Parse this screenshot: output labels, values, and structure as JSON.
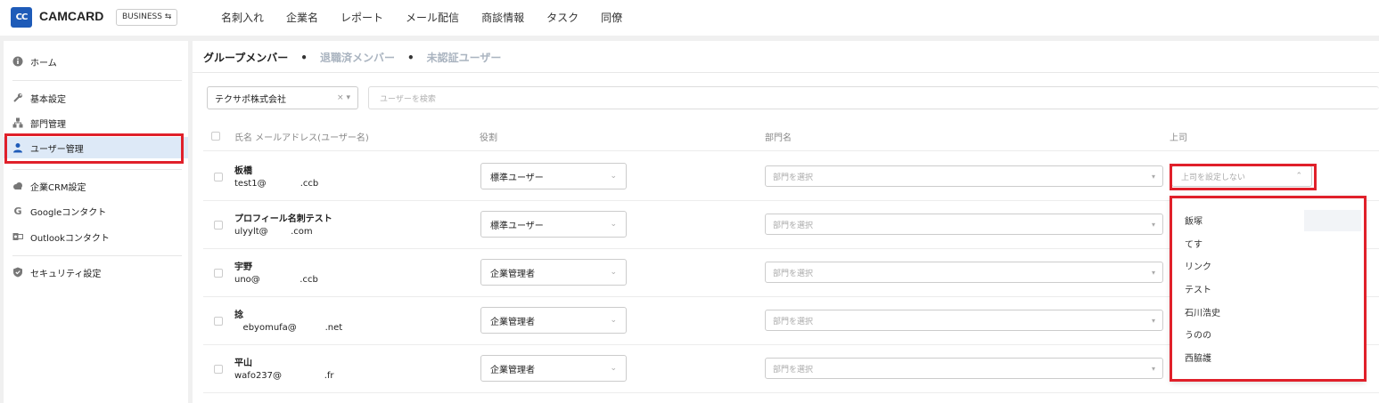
{
  "app": {
    "logo_letters": "CC",
    "name": "CAMCARD",
    "edition": "BUSINESS ⇆"
  },
  "top_nav": [
    "名刺入れ",
    "企業名",
    "レポート",
    "メール配信",
    "商談情報",
    "タスク",
    "同僚"
  ],
  "sidebar": {
    "items": [
      {
        "label": "ホーム",
        "icon": "info-icon"
      },
      {
        "label": "基本設定",
        "icon": "wrench-icon"
      },
      {
        "label": "部門管理",
        "icon": "org-chart-icon"
      },
      {
        "label": "ユーザー管理",
        "icon": "user-icon",
        "active": true
      },
      {
        "label": "企業CRM設定",
        "icon": "cloud-icon"
      },
      {
        "label": "Googleコンタクト",
        "icon": "google-icon"
      },
      {
        "label": "Outlookコンタクト",
        "icon": "outlook-icon"
      },
      {
        "label": "セキュリティ設定",
        "icon": "shield-icon"
      }
    ]
  },
  "tabs": {
    "active": "グループメンバー",
    "retired": "退職済メンバー",
    "unverified": "未認証ユーザー",
    "separator": "•"
  },
  "filters": {
    "company": "テクサポ株式会社",
    "clear": "×",
    "search_placeholder": "ユーザーを検索"
  },
  "table": {
    "headers": {
      "name_email": "氏名 メールアドレス(ユーザー名)",
      "role": "役割",
      "department": "部門名",
      "boss": "上司"
    },
    "dept_placeholder": "部門を選択",
    "boss_placeholder": "上司を設定しない",
    "rows": [
      {
        "name": "板橋",
        "email": "test1@            .ccb",
        "role": "標準ユーザー"
      },
      {
        "name": "プロフィール名刺テスト",
        "email": "ulyylt@        .com",
        "role": "標準ユーザー"
      },
      {
        "name": "宇野",
        "email": "uno@              .ccb",
        "role": "企業管理者"
      },
      {
        "name": "捻",
        "email": "   ebyomufa@          .net",
        "role": "企業管理者"
      },
      {
        "name": "平山",
        "email": "wafo237@               .fr",
        "role": "企業管理者"
      }
    ]
  },
  "boss_dropdown": {
    "options": [
      "飯塚",
      "てす",
      "リンク",
      "テスト",
      "石川浩史",
      "うのの",
      "西脇護"
    ]
  },
  "colors": {
    "accent": "#1e5bb8",
    "highlight": "#e0202a"
  }
}
